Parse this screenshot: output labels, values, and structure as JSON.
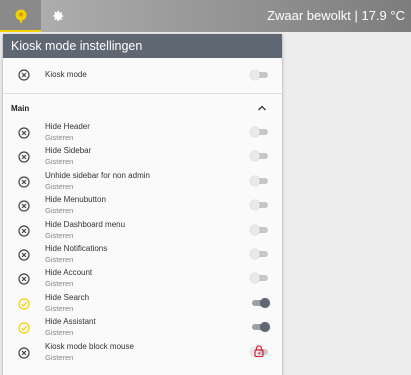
{
  "topbar": {
    "title": "Zwaar bewolkt | 17.9 °C",
    "home_icon": "home-icon",
    "settings_icon": "gear-icon",
    "accent": "#f5d000"
  },
  "panel": {
    "title": "Kiosk mode instellingen",
    "kiosk": {
      "label": "Kiosk mode",
      "on": false,
      "status": "off"
    },
    "section": {
      "title": "Main",
      "expanded": true
    },
    "items": [
      {
        "label": "Hide Header",
        "sub": "Gisteren",
        "status": "off",
        "on": false,
        "locked": false
      },
      {
        "label": "Hide Sidebar",
        "sub": "Gisteren",
        "status": "off",
        "on": false,
        "locked": false
      },
      {
        "label": "Unhide sidebar for non admin",
        "sub": "Gisteren",
        "status": "off",
        "on": false,
        "locked": false
      },
      {
        "label": "Hide Menubutton",
        "sub": "Gisteren",
        "status": "off",
        "on": false,
        "locked": false
      },
      {
        "label": "Hide Dashboard menu",
        "sub": "Gisteren",
        "status": "off",
        "on": false,
        "locked": false
      },
      {
        "label": "Hide Notifications",
        "sub": "Gisteren",
        "status": "off",
        "on": false,
        "locked": false
      },
      {
        "label": "Hide Account",
        "sub": "Gisteren",
        "status": "off",
        "on": false,
        "locked": false
      },
      {
        "label": "Hide Search",
        "sub": "Gisteren",
        "status": "on",
        "on": true,
        "locked": false
      },
      {
        "label": "Hide Assistant",
        "sub": "Gisteren",
        "status": "on",
        "on": true,
        "locked": false
      },
      {
        "label": "Kiosk mode block mouse",
        "sub": "Gisteren",
        "status": "off",
        "on": false,
        "locked": true
      }
    ],
    "colors": {
      "on": "#f5d000",
      "off": "#444444",
      "lock": "#d9243b",
      "toggle_on": "#5f6773"
    }
  }
}
